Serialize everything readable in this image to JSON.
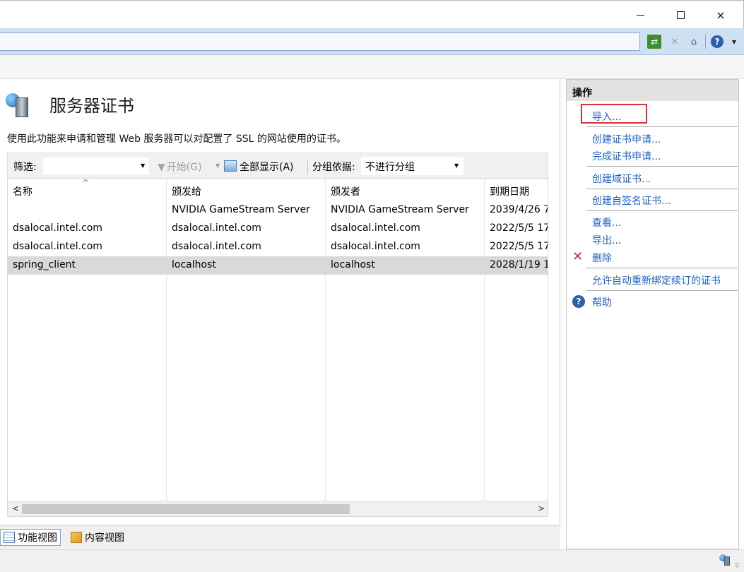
{
  "window": {
    "minimize": "–",
    "maximize": "□",
    "close": "×"
  },
  "toolbar": {
    "refresh_icon": "refresh-icon",
    "stop_icon": "stop-icon",
    "home_icon": "home-icon",
    "help_icon": "help-icon",
    "help_glyph": "?",
    "home_glyph": "⌂",
    "stop_glyph": "✕",
    "refresh_glyph": "⇄",
    "dropdown_glyph": "▼"
  },
  "page": {
    "title": "服务器证书",
    "description": "使用此功能来申请和管理 Web 服务器可以对配置了 SSL 的网站使用的证书。"
  },
  "filterbar": {
    "filter_label": "筛选:",
    "filter_value": "",
    "start_label": "开始(G)",
    "show_all_label": "全部显示(A)",
    "group_label": "分组依据:",
    "group_value": "不进行分组",
    "dropdown_glyph": "▼"
  },
  "grid": {
    "columns": [
      "名称",
      "颁发给",
      "颁发者",
      "到期日期"
    ],
    "sort_glyph": "^",
    "rows": [
      {
        "name": "",
        "issued_to": "NVIDIA GameStream Server",
        "issued_by": "NVIDIA GameStream Server",
        "expires": "2039/4/26 7"
      },
      {
        "name": "dsalocal.intel.com",
        "issued_to": "dsalocal.intel.com",
        "issued_by": "dsalocal.intel.com",
        "expires": "2022/5/5 17"
      },
      {
        "name": "dsalocal.intel.com",
        "issued_to": "dsalocal.intel.com",
        "issued_by": "dsalocal.intel.com",
        "expires": "2022/5/5 17"
      },
      {
        "name": "spring_client",
        "issued_to": "localhost",
        "issued_by": "localhost",
        "expires": "2028/1/19 1"
      }
    ],
    "selected_row": 3,
    "scroll_left": "<",
    "scroll_right": ">"
  },
  "bottom_tabs": {
    "features_view": "功能视图",
    "content_view": "内容视图"
  },
  "actions": {
    "header": "操作",
    "import": "导入...",
    "create_request": "创建证书申请...",
    "complete_request": "完成证书申请...",
    "create_domain_cert": "创建域证书...",
    "create_self_signed": "创建自签名证书...",
    "view": "查看...",
    "export": "导出...",
    "delete": "删除",
    "allow_auto_rebind": "允许自动重新绑定续订的证书",
    "help": "帮助",
    "delete_glyph": "✕",
    "help_glyph": "?"
  },
  "colors": {
    "link": "#1b62c6",
    "highlight_border": "#e0303a",
    "selected_row": "#d9d9d9",
    "addressbar": "#cfe0f2"
  }
}
